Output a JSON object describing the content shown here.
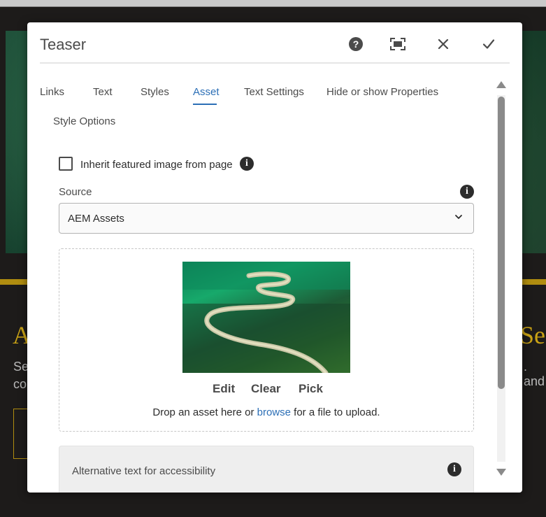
{
  "dialog": {
    "title": "Teaser",
    "help_icon": "question-icon",
    "fullscreen_icon": "fullscreen-icon",
    "close_icon": "close-icon",
    "done_icon": "checkmark-icon"
  },
  "tabs": [
    {
      "label": "Links"
    },
    {
      "label": "Text"
    },
    {
      "label": "Styles"
    },
    {
      "label": "Asset",
      "active": true
    },
    {
      "label": "Text Settings"
    },
    {
      "label": "Hide or show Properties"
    },
    {
      "label": "Style Options"
    }
  ],
  "asset": {
    "inherit_label": "Inherit featured image from page",
    "inherit_checked": false,
    "source_label": "Source",
    "source_value": "AEM Assets",
    "actions": {
      "edit": "Edit",
      "clear": "Clear",
      "pick": "Pick"
    },
    "drop_text_before": "Drop an asset here or",
    "browse_link": "browse",
    "drop_text_after": "for a file to upload.",
    "alt_label": "Alternative text for accessibility"
  },
  "colors": {
    "accent": "#2c6fb6",
    "text": "#4b4b4b",
    "gold": "#b08d10"
  }
}
